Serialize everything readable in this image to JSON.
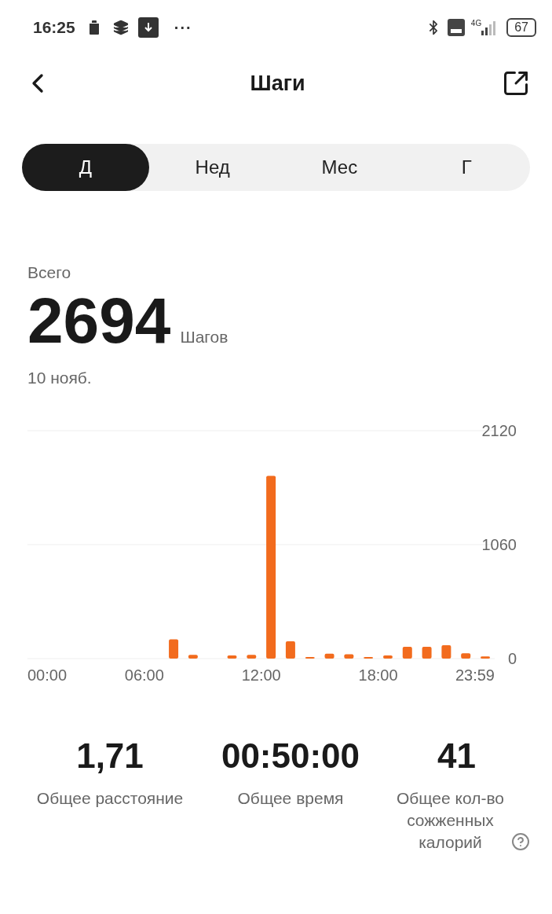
{
  "status_bar": {
    "time": "16:25",
    "more": "···",
    "network": "4G",
    "battery": "67"
  },
  "header": {
    "title": "Шаги"
  },
  "tabs": [
    {
      "label": "Д",
      "selected": true
    },
    {
      "label": "Нед",
      "selected": false
    },
    {
      "label": "Мес",
      "selected": false
    },
    {
      "label": "Г",
      "selected": false
    }
  ],
  "summary": {
    "label": "Всего",
    "value": "2694",
    "unit": "Шагов",
    "date": "10 нояб."
  },
  "chart_data": {
    "type": "bar",
    "x": [
      450,
      510,
      630,
      690,
      750,
      810,
      870,
      930,
      990,
      1050,
      1110,
      1170,
      1230,
      1290,
      1350,
      1410
    ],
    "series": [
      {
        "color": "#f26b1d",
        "values": [
          180,
          35,
          30,
          35,
          1700,
          160,
          15,
          45,
          40,
          15,
          30,
          110,
          110,
          125,
          50,
          20
        ]
      }
    ],
    "xlim": [
      0,
      1439
    ],
    "ylim": [
      0,
      2120
    ],
    "xticks": [
      {
        "value": 0,
        "label": "00:00"
      },
      {
        "value": 360,
        "label": "06:00"
      },
      {
        "value": 720,
        "label": "12:00"
      },
      {
        "value": 1080,
        "label": "18:00"
      },
      {
        "value": 1439,
        "label": "23:59"
      }
    ],
    "yticks": [
      0,
      1060,
      2120
    ]
  },
  "stats": [
    {
      "value": "1,71",
      "label": "Общее расстояние",
      "info": false
    },
    {
      "value": "00:50:00",
      "label": "Общее время",
      "info": false
    },
    {
      "value": "41",
      "label": "Общее кол-во сожженных калорий",
      "info": true
    }
  ]
}
